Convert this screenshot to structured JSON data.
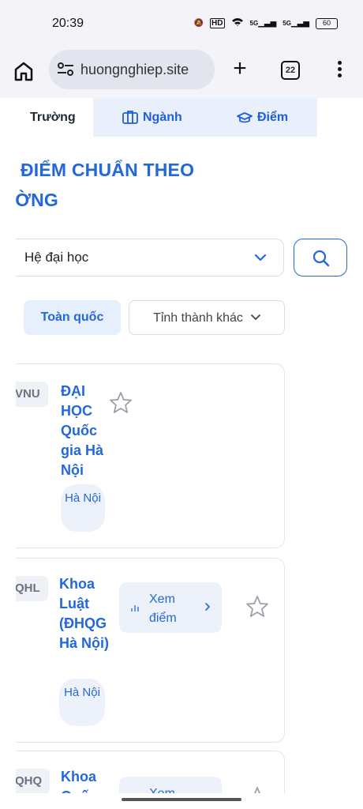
{
  "status": {
    "time": "20:39",
    "battery": "60",
    "hd_label": "HD",
    "net1": "5G",
    "net2": "5G"
  },
  "browser": {
    "url": "huongnghiep.site",
    "tab_count": "22"
  },
  "tabs": [
    {
      "label": "Trường",
      "icon": "school-icon",
      "active": true
    },
    {
      "label": "Ngành",
      "icon": "briefcase-icon",
      "active": false
    },
    {
      "label": "Điểm",
      "icon": "graduation-cap-icon",
      "active": false
    }
  ],
  "heading": {
    "line1": "M ĐIỂM CHUẨN THEO",
    "line2": "ƯỜNG"
  },
  "filter": {
    "system_value": "Hệ đại học"
  },
  "regions": {
    "all": "Toàn quốc",
    "other": "Tỉnh thành khác"
  },
  "universities": [
    {
      "code": "VNU",
      "name": "ĐẠI HỌC Quốc gia Hà Nội",
      "location": "Hà Nội",
      "view_label": ""
    },
    {
      "code": "QHL",
      "name": "Khoa Luật (ĐHQG Hà Nội)",
      "location": "Hà Nội",
      "view_label": "Xem điểm"
    },
    {
      "code": "QHQ",
      "name": "Khoa Quốc",
      "location": "",
      "view_label": "Xem"
    }
  ]
}
